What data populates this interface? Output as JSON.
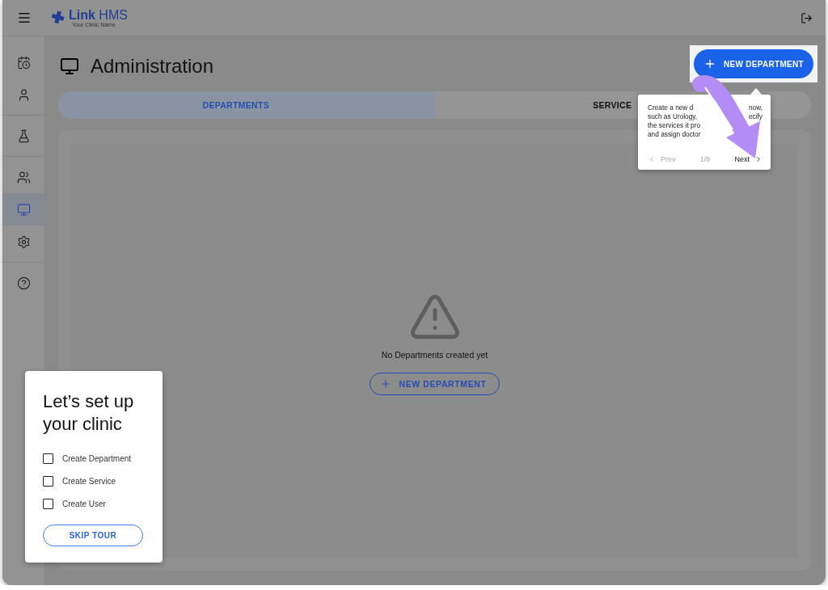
{
  "header": {
    "brand": "Link",
    "brand_suffix": "HMS",
    "tagline": "Your Clinic Name"
  },
  "sidebar": {
    "groups": [
      [
        {
          "selected": false
        },
        {
          "selected": false
        }
      ],
      [
        {
          "selected": false
        }
      ],
      [
        {
          "selected": false
        },
        {
          "selected": true
        },
        {
          "selected": false
        }
      ],
      [
        {
          "selected": false
        }
      ]
    ]
  },
  "page": {
    "title": "Administration",
    "action": "NEW DEPARTMENT"
  },
  "tabs": [
    {
      "label": "DEPARTMENTS",
      "selected": true
    },
    {
      "label": "SERVICE",
      "selected": false
    }
  ],
  "empty_state": {
    "message": "No Departments created yet",
    "action": "NEW DEPARTMENT"
  },
  "tour_tip": {
    "lines": [
      [
        "Create a new d",
        "now,"
      ],
      [
        "such as Urology,",
        "ecify"
      ],
      [
        "the services it pro"
      ],
      [
        "and assign doctor"
      ]
    ],
    "prev": "Prev",
    "step": "1/8",
    "next": "Next"
  },
  "setup": {
    "title": "Let’s set up your clinic",
    "tasks": [
      {
        "label": "Create Department",
        "checked": false
      },
      {
        "label": "Create Service",
        "checked": false
      },
      {
        "label": "Create User",
        "checked": false
      }
    ],
    "skip": "SKIP TOUR"
  }
}
